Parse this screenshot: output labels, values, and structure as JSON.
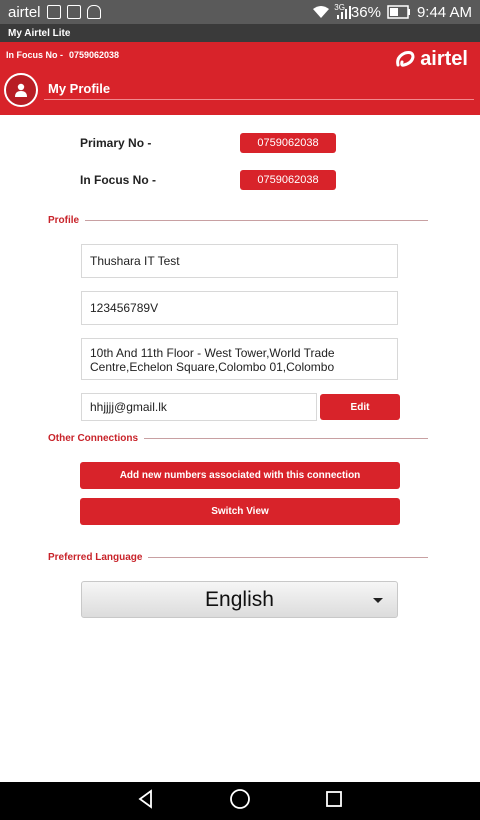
{
  "status_bar": {
    "carrier": "airtel",
    "signal_label": "3G",
    "battery": "36%",
    "time": "9:44 AM"
  },
  "app_title": "My Airtel Lite",
  "header": {
    "focus_label": "In Focus No -",
    "focus_number": "0759062038",
    "brand": "airtel",
    "page_title": "My Profile"
  },
  "numbers": {
    "primary_label": "Primary No -",
    "primary_value": "0759062038",
    "focus_label": "In Focus No -",
    "focus_value": "0759062038"
  },
  "profile": {
    "section_label": "Profile",
    "name": "Thushara IT Test",
    "id_number": "123456789V",
    "address_line1": "10th And 11th Floor - West Tower,World Trade",
    "address_line2": "Centre,Echelon Square,Colombo 01,Colombo",
    "email": "hhjjjj@gmail.lk",
    "edit_label": "Edit"
  },
  "other_connections": {
    "section_label": "Other Connections",
    "add_label": "Add new numbers associated with this connection",
    "switch_label": "Switch View"
  },
  "language": {
    "section_label": "Preferred Language",
    "selected": "English"
  },
  "colors": {
    "brand_red": "#d8232a",
    "status_bar": "#5a5a5a"
  }
}
